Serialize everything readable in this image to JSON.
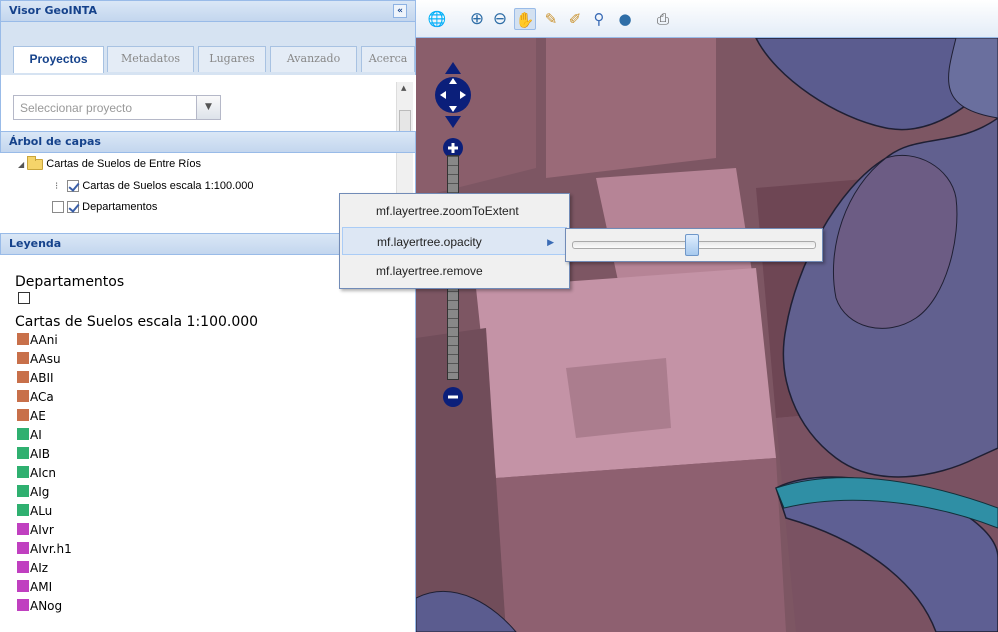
{
  "panel": {
    "title": "Visor GeoINTA",
    "collapse_icon": "double-chevron-left"
  },
  "tabs": [
    "Proyectos",
    "Metadatos",
    "Lugares",
    "Avanzado",
    "Acerca"
  ],
  "project_select": {
    "placeholder": "Seleccionar proyecto"
  },
  "layer_tree": {
    "title": "Árbol de capas",
    "root": "Cartas de Suelos de Entre Ríos",
    "children": [
      {
        "label": "Cartas de Suelos escala 1:100.000",
        "checked": true
      },
      {
        "label": "Departamentos",
        "checked": true
      }
    ]
  },
  "legend": {
    "title": "Leyenda",
    "group1": "Departamentos",
    "group2": "Cartas de Suelos escala 1:100.000",
    "items": [
      {
        "label": "AAni",
        "color": "#c8704a"
      },
      {
        "label": "AAsu",
        "color": "#c8704a"
      },
      {
        "label": "ABII",
        "color": "#c8704a"
      },
      {
        "label": "ACa",
        "color": "#c8704a"
      },
      {
        "label": "AE",
        "color": "#c8704a"
      },
      {
        "label": "AI",
        "color": "#2fb070"
      },
      {
        "label": "AIB",
        "color": "#2fb070"
      },
      {
        "label": "AIcn",
        "color": "#2fb070"
      },
      {
        "label": "AIg",
        "color": "#2fb070"
      },
      {
        "label": "ALu",
        "color": "#2fb070"
      },
      {
        "label": "AIvr",
        "color": "#c040c0"
      },
      {
        "label": "AIvr.h1",
        "color": "#c040c0"
      },
      {
        "label": "AIz",
        "color": "#c040c0"
      },
      {
        "label": "AMI",
        "color": "#c040c0"
      },
      {
        "label": "ANog",
        "color": "#c040c0"
      }
    ]
  },
  "toolbar": [
    "globe-icon",
    "zoom-in-icon",
    "zoom-out-icon",
    "pan-hand-icon",
    "measure-length-icon",
    "measure-area-icon",
    "identify-icon",
    "info-icon",
    "print-icon"
  ],
  "context_menu": {
    "items": [
      "mf.layertree.zoomToExtent",
      "mf.layertree.opacity",
      "mf.layertree.remove"
    ],
    "opacity": 0.49
  }
}
